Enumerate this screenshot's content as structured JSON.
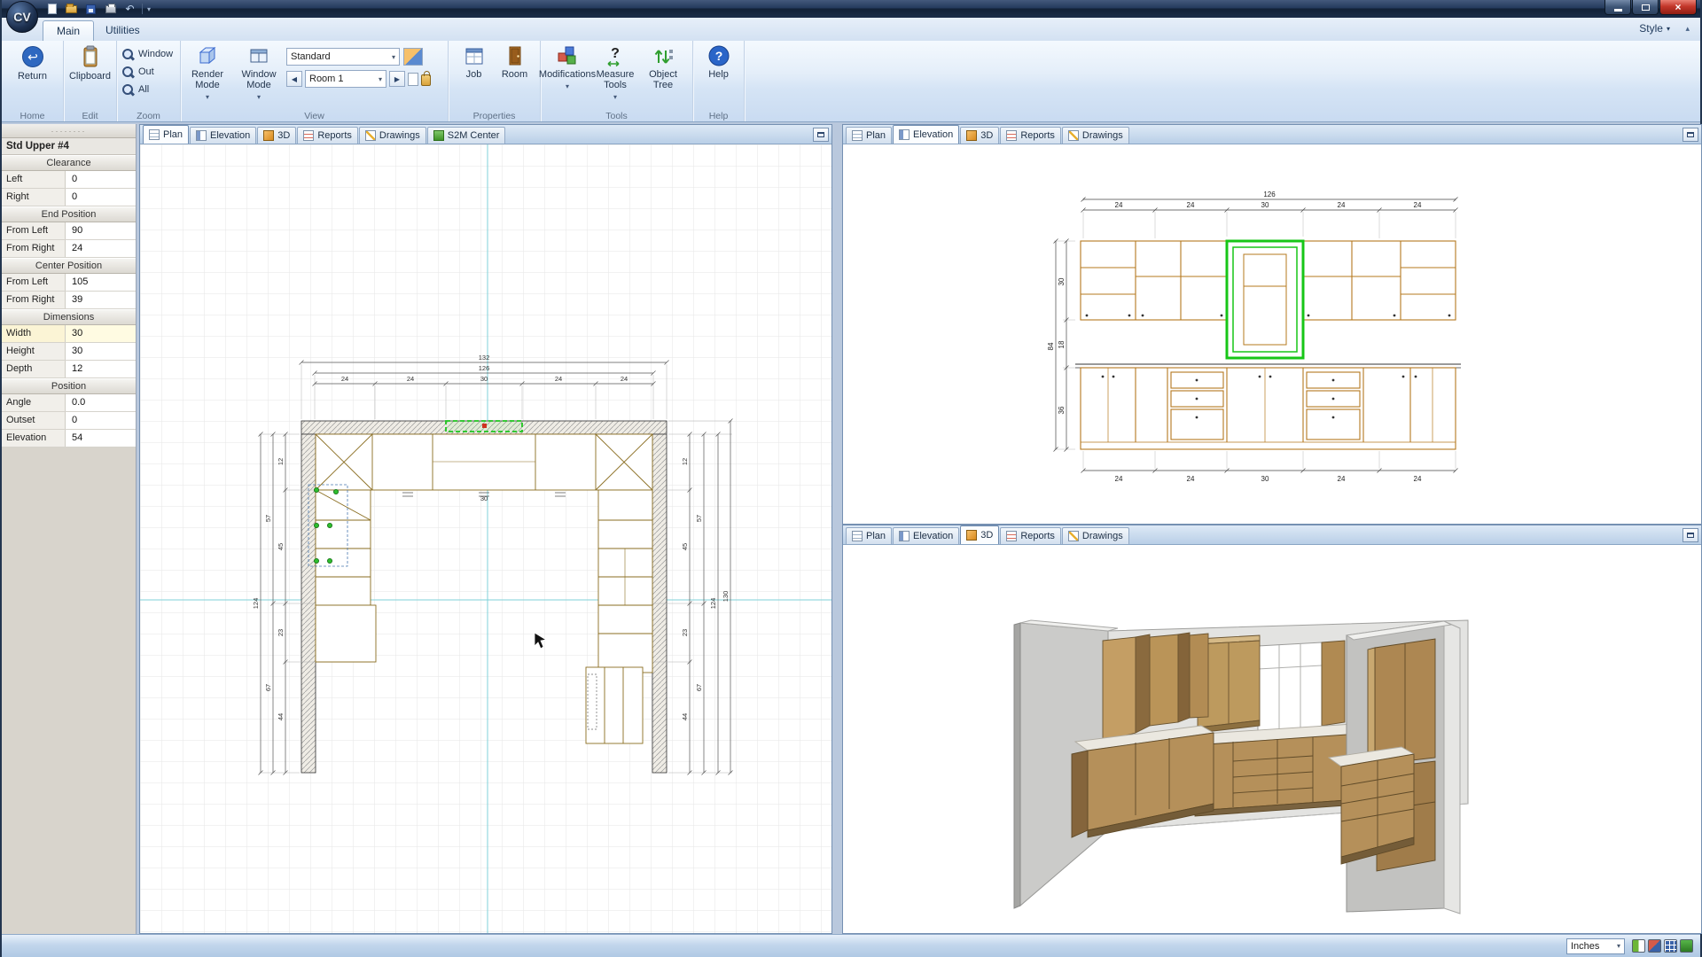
{
  "titlebar": {
    "logo": "CV"
  },
  "ribbon": {
    "tabs": [
      "Main",
      "Utilities"
    ],
    "style_button": "Style",
    "groups": {
      "home": {
        "label": "Home",
        "return_btn": "Return"
      },
      "edit": {
        "label": "Edit",
        "clipboard": "Clipboard"
      },
      "zoom": {
        "label": "Zoom",
        "window": "Window",
        "out": "Out",
        "all": "All"
      },
      "view": {
        "label": "View",
        "render_mode": "Render Mode",
        "window_mode": "Window Mode",
        "style_value": "Standard",
        "room_value": "Room 1"
      },
      "properties": {
        "label": "Properties",
        "job": "Job",
        "room": "Room"
      },
      "tools": {
        "label": "Tools",
        "modifications": "Modifications",
        "measure_tools": "Measure Tools",
        "object_tree": "Object Tree"
      },
      "help": {
        "label": "Help",
        "help_btn": "Help"
      }
    }
  },
  "panel": {
    "title": "Std Upper #4",
    "sections": [
      {
        "header": "Clearance",
        "rows": [
          {
            "label": "Left",
            "value": "0"
          },
          {
            "label": "Right",
            "value": "0"
          }
        ]
      },
      {
        "header": "End Position",
        "rows": [
          {
            "label": "From Left",
            "value": "90"
          },
          {
            "label": "From Right",
            "value": "24"
          }
        ]
      },
      {
        "header": "Center Position",
        "rows": [
          {
            "label": "From Left",
            "value": "105"
          },
          {
            "label": "From Right",
            "value": "39"
          }
        ]
      },
      {
        "header": "Dimensions",
        "rows": [
          {
            "label": "Width",
            "value": "30"
          },
          {
            "label": "Height",
            "value": "30"
          },
          {
            "label": "Depth",
            "value": "12"
          }
        ]
      },
      {
        "header": "Position",
        "rows": [
          {
            "label": "Angle",
            "value": "0.0"
          },
          {
            "label": "Outset",
            "value": "0"
          },
          {
            "label": "Elevation",
            "value": "54"
          }
        ]
      }
    ]
  },
  "viewports": {
    "plan": {
      "tabs": [
        "Plan",
        "Elevation",
        "3D",
        "Reports",
        "Drawings",
        "S2M Center"
      ]
    },
    "elevation": {
      "tabs": [
        "Plan",
        "Elevation",
        "3D",
        "Reports",
        "Drawings"
      ]
    },
    "three_d": {
      "tabs": [
        "Plan",
        "Elevation",
        "3D",
        "Reports",
        "Drawings"
      ]
    }
  },
  "plan_dims": {
    "top_overall_outer": "132",
    "top_overall": "126",
    "top_segments": [
      "24",
      "24",
      "30",
      "24",
      "24"
    ],
    "left_inner": [
      "12",
      "45",
      "23",
      "44"
    ],
    "left_mid": [
      "57",
      "67"
    ],
    "left_overall": "124",
    "right_inner": [
      "12",
      "45",
      "23",
      "44"
    ],
    "right_mid": [
      "57",
      "67"
    ],
    "right_overall": "124",
    "right_outer": "130",
    "center_width": "30"
  },
  "elev_dims": {
    "top_overall": "126",
    "top_segments": [
      "24",
      "24",
      "30",
      "24",
      "24"
    ],
    "left": [
      "30",
      "18",
      "36"
    ],
    "left_overall": "84",
    "bottom_segments": [
      "24",
      "24",
      "30",
      "24",
      "24"
    ]
  },
  "statusbar": {
    "units": "Inches"
  }
}
